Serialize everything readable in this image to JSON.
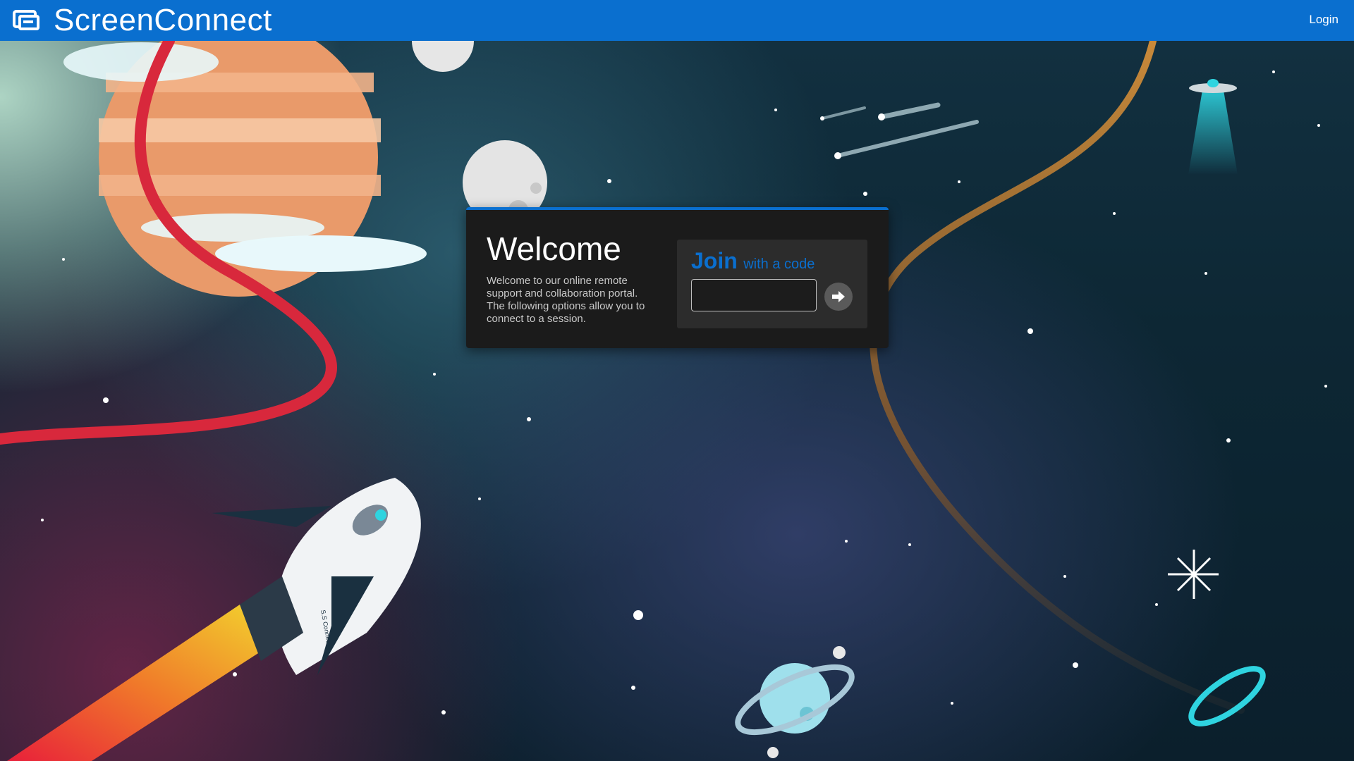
{
  "header": {
    "brand_name": "ScreenConnect",
    "login_label": "Login",
    "color": "#0a6fcf",
    "logo_icon": "screenconnect-logo-icon"
  },
  "welcome": {
    "title": "Welcome",
    "text": "Welcome to our online remote support and collaboration portal. The following options allow you to connect to a session."
  },
  "join": {
    "heading": "Join",
    "subheading": "with a code",
    "input_value": "",
    "input_placeholder": "",
    "submit_icon": "arrow-right-icon"
  },
  "background": {
    "rocket_label": "S.S Connect"
  }
}
